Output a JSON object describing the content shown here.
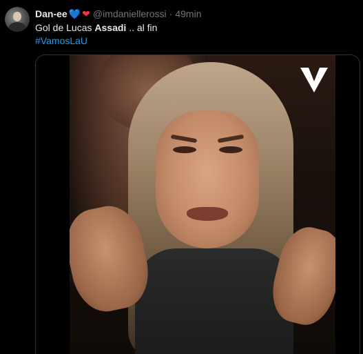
{
  "tweet": {
    "display_name": "Dan-ee",
    "hearts": [
      "💙",
      "❤"
    ],
    "handle": "@imdaniellerossi",
    "separator": "·",
    "time": "49min",
    "text_prefix": "Gol de Lucas ",
    "text_bold": "Assadi",
    "text_suffix": " .. al fin",
    "hashtag": "#VamosLaU"
  },
  "media": {
    "type": "video",
    "watermark_icon": "v-logo-icon"
  },
  "colors": {
    "background": "#000000",
    "text": "#e7e9ea",
    "muted": "#71767b",
    "link": "#1d9bf0",
    "border": "#2f3336"
  }
}
